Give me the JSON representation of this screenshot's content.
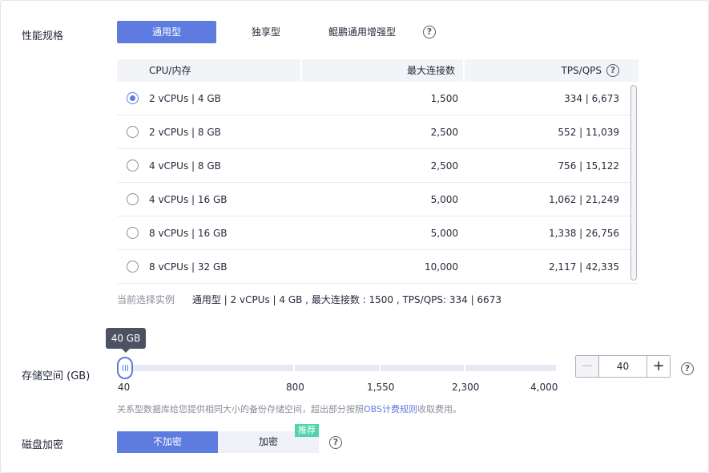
{
  "perf_spec": {
    "label": "性能规格",
    "tabs": [
      {
        "label": "通用型",
        "active": true
      },
      {
        "label": "独享型",
        "active": false
      },
      {
        "label": "鲲鹏通用增强型",
        "active": false
      }
    ],
    "help_icon": "question-circle-icon"
  },
  "spec_table": {
    "headers": {
      "cpu": "CPU/内存",
      "connections": "最大连接数",
      "tps": "TPS/QPS"
    },
    "rows": [
      {
        "cpu": "2 vCPUs | 4 GB",
        "connections": "1,500",
        "tps": "334 | 6,673",
        "selected": true
      },
      {
        "cpu": "2 vCPUs | 8 GB",
        "connections": "2,500",
        "tps": "552 | 11,039",
        "selected": false
      },
      {
        "cpu": "4 vCPUs | 8 GB",
        "connections": "2,500",
        "tps": "756 | 15,122",
        "selected": false
      },
      {
        "cpu": "4 vCPUs | 16 GB",
        "connections": "5,000",
        "tps": "1,062 | 21,249",
        "selected": false
      },
      {
        "cpu": "8 vCPUs | 16 GB",
        "connections": "5,000",
        "tps": "1,338 | 26,756",
        "selected": false
      },
      {
        "cpu": "8 vCPUs | 32 GB",
        "connections": "10,000",
        "tps": "2,117 | 42,335",
        "selected": false
      }
    ]
  },
  "current_selection": {
    "label": "当前选择实例",
    "value": "通用型 | 2 vCPUs | 4 GB , 最大连接数 : 1500 , TPS/QPS: 334 | 6673"
  },
  "storage": {
    "label": "存储空间 (GB)",
    "tooltip": "40 GB",
    "value": 40,
    "ticks": [
      "40",
      "800",
      "1,550",
      "2,300",
      "4,000"
    ],
    "stepper_value": "40",
    "minus": "−",
    "plus": "+",
    "note_prefix": "关系型数据库给您提供相同大小的备份存储空间，超出部分按照",
    "note_link": "OBS计费规则",
    "note_suffix": "收取费用。"
  },
  "encryption": {
    "label": "磁盘加密",
    "options": [
      {
        "label": "不加密",
        "active": true
      },
      {
        "label": "加密",
        "active": false,
        "badge": "推荐"
      }
    ]
  },
  "colors": {
    "accent": "#5e7ce0",
    "badge": "#50d4ab"
  }
}
